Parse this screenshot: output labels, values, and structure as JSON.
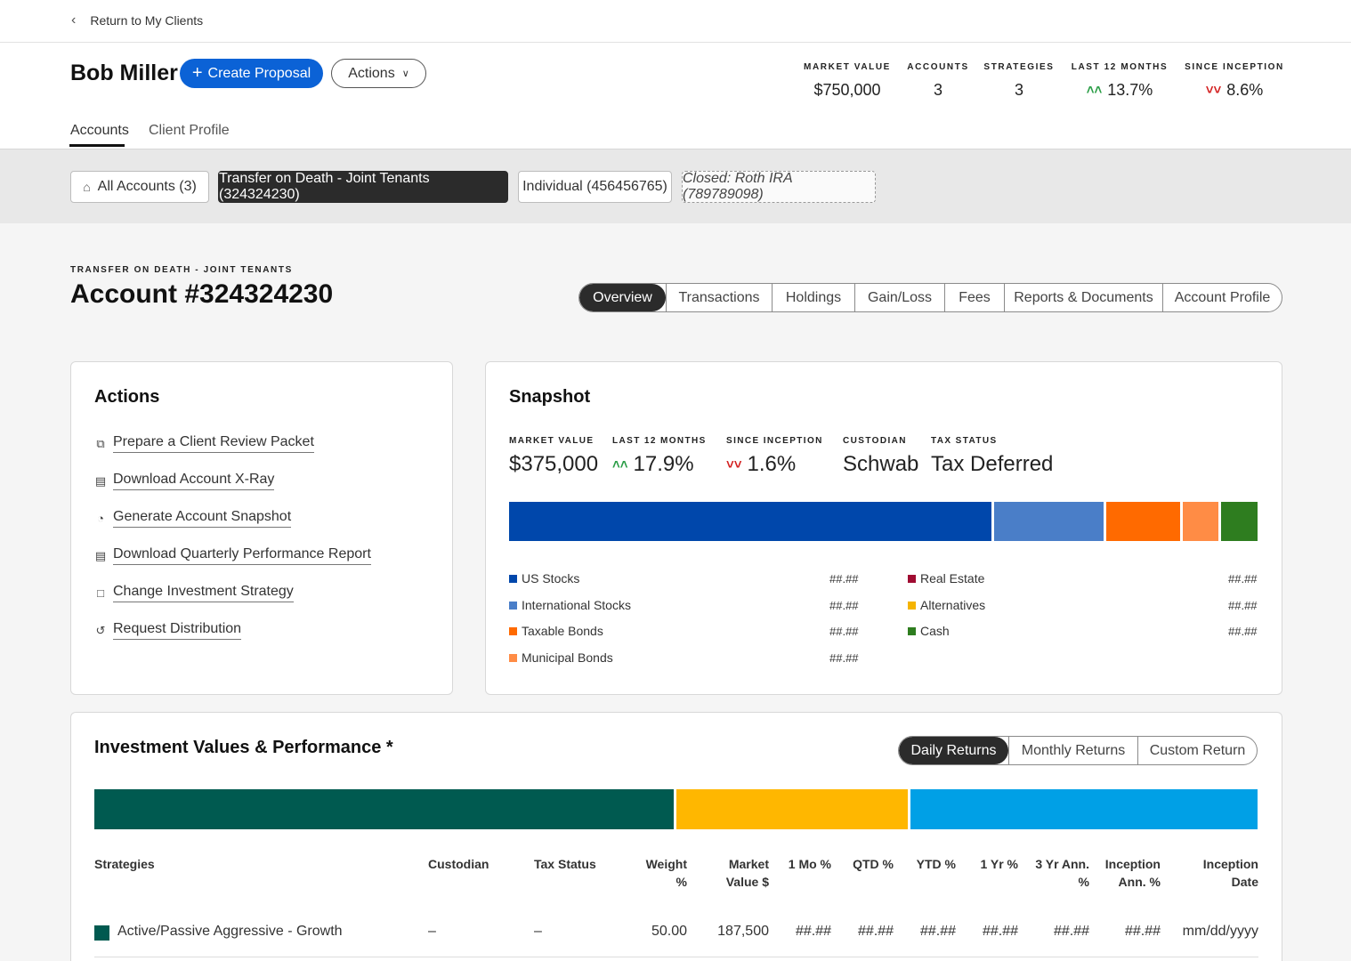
{
  "nav": {
    "back_label": "Return to My Clients"
  },
  "client": {
    "name": "Bob Miller",
    "create_proposal_label": "Create Proposal",
    "actions_label": "Actions",
    "tabs": [
      "Accounts",
      "Client Profile"
    ]
  },
  "summary": [
    {
      "label": "MARKET VALUE",
      "value": "$750,000",
      "trend": "none"
    },
    {
      "label": "ACCOUNTS",
      "value": "3",
      "trend": "none"
    },
    {
      "label": "STRATEGIES",
      "value": "3",
      "trend": "none"
    },
    {
      "label": "LAST 12 MONTHS",
      "value": "13.7%",
      "trend": "up"
    },
    {
      "label": "SINCE INCEPTION",
      "value": "8.6%",
      "trend": "down"
    }
  ],
  "account_chips": [
    "All Accounts (3)",
    "Transfer on Death - Joint Tenants (324324230)",
    "Individual (456456765)",
    "Closed: Roth IRA (789789098)"
  ],
  "account": {
    "type": "TRANSFER ON DEATH - JOINT TENANTS",
    "title": "Account #324324230",
    "tabs": [
      "Overview",
      "Transactions",
      "Holdings",
      "Gain/Loss",
      "Fees",
      "Reports & Documents",
      "Account Profile"
    ]
  },
  "actions_card": {
    "title": "Actions",
    "items": [
      {
        "label": "Prepare a Client Review Packet",
        "icon": "copy-icon"
      },
      {
        "label": "Download Account X-Ray",
        "icon": "download-icon"
      },
      {
        "label": "Generate Account Snapshot",
        "icon": "pie-chart-icon"
      },
      {
        "label": "Download Quarterly Performance Report",
        "icon": "document-icon"
      },
      {
        "label": "Change Investment Strategy",
        "icon": "swap-icon"
      },
      {
        "label": "Request Distribution",
        "icon": "distribution-icon"
      }
    ]
  },
  "snapshot": {
    "title": "Snapshot",
    "metrics": [
      {
        "label": "MARKET VALUE",
        "value": "$375,000",
        "trend": "none"
      },
      {
        "label": "LAST 12 MONTHS",
        "value": "17.9%",
        "trend": "up"
      },
      {
        "label": "SINCE INCEPTION",
        "value": "1.6%",
        "trend": "down"
      },
      {
        "label": "CUSTODIAN",
        "value": "Schwab",
        "trend": "none"
      },
      {
        "label": "TAX STATUS",
        "value": "Tax Deferred",
        "trend": "none"
      }
    ],
    "allocation": [
      {
        "name": "US Stocks",
        "color": "#0047ab",
        "value": "##.##",
        "share": 65.1
      },
      {
        "name": "International Stocks",
        "color": "#4a7ec8",
        "value": "##.##",
        "share": 14.8
      },
      {
        "name": "Taxable Bonds",
        "color": "#ff6a00",
        "value": "##.##",
        "share": 10
      },
      {
        "name": "Municipal Bonds",
        "color": "#ff8c45",
        "value": "##.##",
        "share": 4.8
      },
      {
        "name": "Real Estate",
        "color": "#a00c32",
        "value": "##.##",
        "share": 0
      },
      {
        "name": "Alternatives",
        "color": "#f5b400",
        "value": "##.##",
        "share": 0
      },
      {
        "name": "Cash",
        "color": "#2e7d1f",
        "value": "##.##",
        "share": 4.8
      }
    ]
  },
  "performance": {
    "title": "Investment Values & Performance *",
    "tabs": [
      "Daily Returns",
      "Monthly Returns",
      "Custom Return"
    ],
    "strategy_bar": [
      {
        "color": "#005a50",
        "share": 50
      },
      {
        "color": "#ffb700",
        "share": 20
      },
      {
        "color": "#00a0e6",
        "share": 30
      }
    ],
    "columns": [
      "Strategies",
      "Custodian",
      "Tax Status",
      "Weight %",
      "Market Value $",
      "1 Mo %",
      "QTD %",
      "YTD %",
      "1 Yr %",
      "3 Yr Ann. %",
      "Inception Ann. %",
      "Inception Date"
    ],
    "rows": [
      {
        "color": "#005a50",
        "cells": [
          "Active/Passive Aggressive - Growth",
          "–",
          "–",
          "50.00",
          "187,500",
          "##.##",
          "##.##",
          "##.##",
          "##.##",
          "##.##",
          "##.##",
          "mm/dd/yyyy"
        ]
      }
    ]
  }
}
